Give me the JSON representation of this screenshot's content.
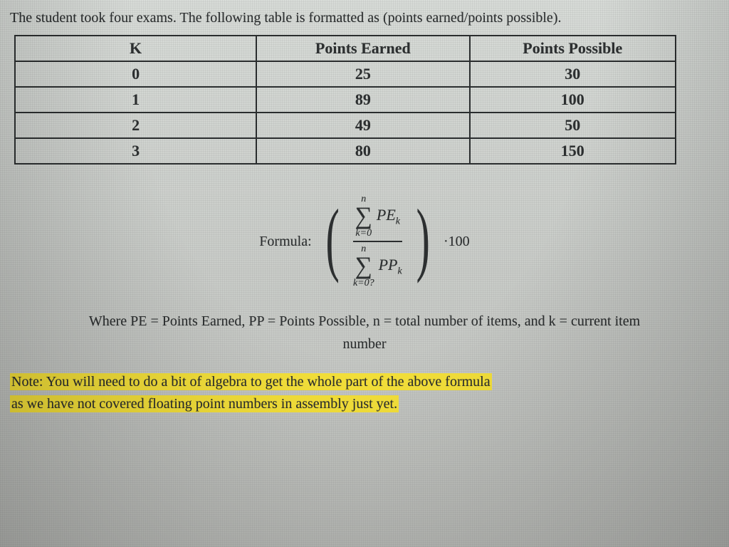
{
  "prompt": "The student took four exams. The following table is formatted as (points earned/points possible).",
  "table": {
    "headers": [
      "K",
      "Points Earned",
      "Points Possible"
    ],
    "rows": [
      {
        "k": "0",
        "pe": "25",
        "pp": "30"
      },
      {
        "k": "1",
        "pe": "89",
        "pp": "100"
      },
      {
        "k": "2",
        "pe": "49",
        "pp": "50"
      },
      {
        "k": "3",
        "pe": "80",
        "pp": "150"
      }
    ]
  },
  "formula": {
    "label": "Formula:",
    "numerator_upper": "n",
    "numerator_lower": "k=0",
    "numerator_term": "PE",
    "numerator_sub": "k",
    "denominator_upper": "n",
    "denominator_lower": "k=0?",
    "denominator_term": "PP",
    "denominator_sub": "k",
    "multiplier": "·100"
  },
  "where_line1": "Where PE = Points Earned, PP = Points Possible, n = total number of items, and k = current item",
  "where_line2": "number",
  "note_line1": "Note: You will need to do a bit of algebra to get the whole part of the above formula",
  "note_line2": "as we have not covered floating point numbers in assembly just yet."
}
